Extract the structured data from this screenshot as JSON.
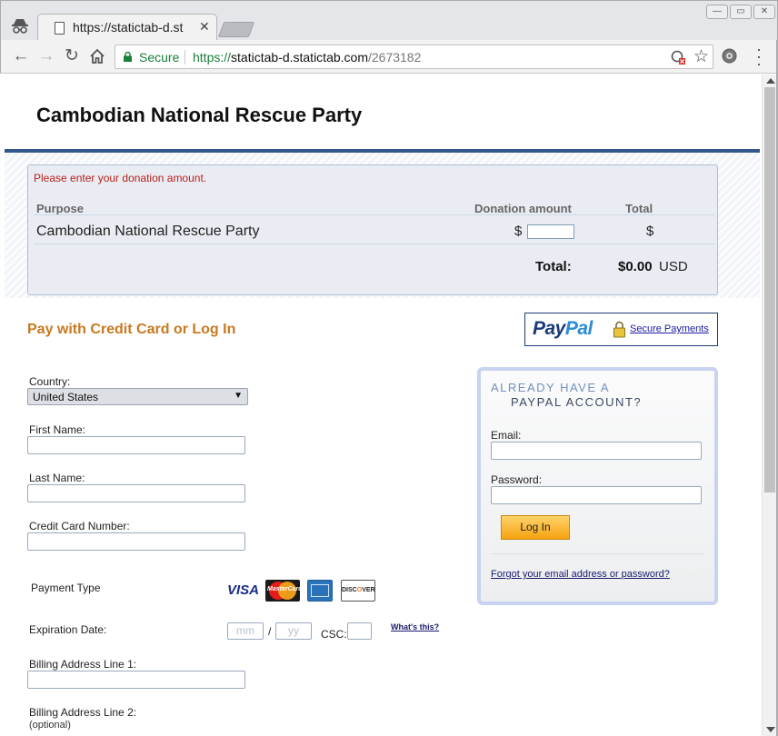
{
  "browser": {
    "tab_title": "https://statictab-d.st",
    "secure_label": "Secure",
    "url_scheme": "https://",
    "url_host": "statictab-d.statictab.com",
    "url_path": "/2673182"
  },
  "page": {
    "title": "Cambodian National Rescue Party",
    "error_message": "Please enter your donation amount.",
    "table": {
      "headers": {
        "purpose": "Purpose",
        "amount": "Donation amount",
        "total": "Total"
      },
      "row": {
        "purpose": "Cambodian National Rescue Party",
        "amount_currency": "$",
        "amount_value": "",
        "total_currency": "$"
      },
      "total_label": "Total:",
      "total_value": "$0.00",
      "total_currency": "USD"
    },
    "pay_heading": "Pay with Credit Card or Log In",
    "paypal": {
      "logo_pay": "Pay",
      "logo_pal": "Pal",
      "secure_link": "Secure Payments"
    }
  },
  "form": {
    "country_label": "Country:",
    "country_value": "United States",
    "first_name_label": "First Name:",
    "last_name_label": "Last Name:",
    "card_number_label": "Credit Card Number:",
    "payment_type_label": "Payment Type",
    "cards": {
      "visa": "VISA",
      "mastercard": "MasterCard",
      "discover_a": "DISC",
      "discover_o": "O",
      "discover_b": "VER"
    },
    "expiration_label": "Expiration Date:",
    "mm_placeholder": "mm",
    "slash": "/",
    "yy_placeholder": "yy",
    "csc_label": "CSC:",
    "whats_this": "What's this?",
    "billing1_label": "Billing Address Line 1:",
    "billing2_label": "Billing Address Line 2:",
    "optional_label": "(optional)"
  },
  "login": {
    "heading_line1": "ALREADY HAVE A",
    "heading_line2": "PAYPAL ACCOUNT?",
    "email_label": "Email:",
    "password_label": "Password:",
    "login_button": "Log In",
    "forgot_link": "Forgot your email address or password?"
  },
  "colors": {
    "accent_heading": "#c7791f",
    "rule_blue": "#34578f",
    "error_red": "#b9201c",
    "secure_green": "#188038"
  }
}
